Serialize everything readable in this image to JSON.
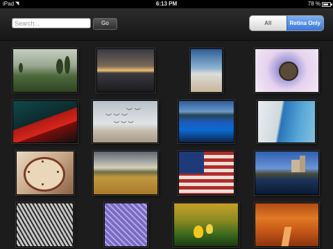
{
  "status_bar": {
    "carrier": "iPad",
    "time": "6:13 PM",
    "battery": "78 %",
    "battery_level": 0.78
  },
  "toolbar": {
    "search_placeholder": "Search...",
    "go_label": "Go",
    "filter_options": [
      "All",
      "Retina Only"
    ],
    "filter_selected": "Retina Only",
    "accent_color": "#3b77d8"
  },
  "gallery": {
    "columns": 4,
    "rows_visible": 4,
    "photos": [
      {
        "subject": "misty green field"
      },
      {
        "subject": "sunset over water"
      },
      {
        "subject": "calm horizon"
      },
      {
        "subject": "tiny planet panorama"
      },
      {
        "subject": "red roof architecture"
      },
      {
        "subject": "seagulls on beach"
      },
      {
        "subject": "blue lake and mountains"
      },
      {
        "subject": "white cliffs and sea"
      },
      {
        "subject": "melting clock"
      },
      {
        "subject": "wheat field and clouds"
      },
      {
        "subject": "american flag"
      },
      {
        "subject": "castle by the lake"
      },
      {
        "subject": "leaf macro"
      },
      {
        "subject": "purple leaf veins"
      },
      {
        "subject": "yellow tulips"
      },
      {
        "subject": "autumn tree path"
      }
    ]
  }
}
